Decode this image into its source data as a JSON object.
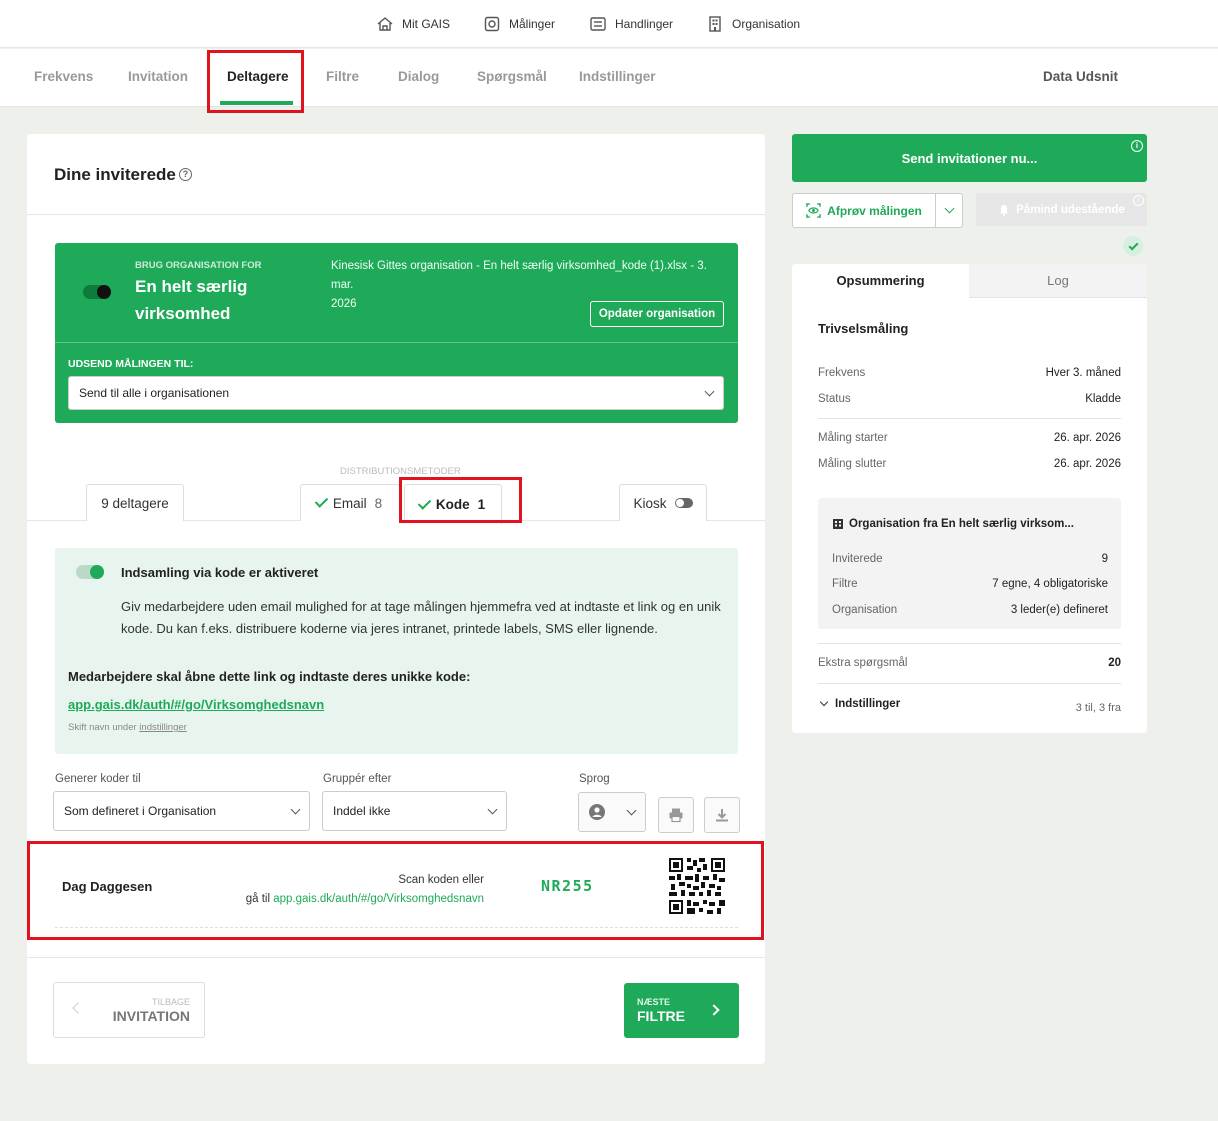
{
  "topnav": {
    "items": [
      {
        "label": "Mit GAIS",
        "icon": "home-icon"
      },
      {
        "label": "Målinger",
        "icon": "survey-icon"
      },
      {
        "label": "Handlinger",
        "icon": "actions-icon"
      },
      {
        "label": "Organisation",
        "icon": "building-icon"
      }
    ]
  },
  "subnav": {
    "tabs": [
      "Frekvens",
      "Invitation",
      "Deltagere",
      "Filtre",
      "Dialog",
      "Spørgsmål",
      "Indstillinger"
    ],
    "active": "Deltagere",
    "right_label": "Data Udsnit"
  },
  "main": {
    "title": "Dine inviterede",
    "org_box": {
      "small_label": "BRUG ORGANISATION FOR",
      "org_name_line1": "En helt særlig",
      "org_name_line2": "virksomhed",
      "file_info_line1": "Kinesisk Gittes organisation - En helt særlig virksomhed_kode (1).xlsx - 3. mar.",
      "file_info_line2": "2026",
      "update_button": "Opdater organisation",
      "send_label": "UDSEND MÅLINGEN TIL:",
      "send_select": "Send til alle i organisationen"
    },
    "distribution": {
      "label": "DISTRIBUTIONSMETODER",
      "participants_tab": "9  deltagere",
      "email_tab": "Email",
      "email_count": "8",
      "code_tab": "Kode",
      "code_count": "1",
      "kiosk_tab": "Kiosk"
    },
    "code_box": {
      "title": "Indsamling via kode er aktiveret",
      "description_line1": "Giv medarbejdere uden email mulighed for at tage målingen hjemmefra ved at indtaste et link og en unik",
      "description_line2": "kode. Du kan f.eks. distribuere koderne via jeres intranet, printede labels, SMS eller lignende.",
      "link_heading": "Medarbejdere skal åbne dette link og indtaste deres unikke kode:",
      "link": "app.gais.dk/auth/#/go/Virksomghedsnavn",
      "rename_hint_prefix": "Skift navn under",
      "rename_hint_link": "indstillinger"
    },
    "controls": {
      "generate_label": "Generer koder til",
      "generate_value": "Som defineret i Organisation",
      "group_label": "Gruppér efter",
      "group_value": "Inddel ikke",
      "language_label": "Sprog"
    },
    "code_row": {
      "name": "Dag Daggesen",
      "scan_text": "Scan koden eller",
      "goto_prefix": "gå til",
      "goto_link": "app.gais.dk/auth/#/go/Virksomghedsnavn",
      "code": "NR255"
    },
    "footer": {
      "back_small": "TILBAGE",
      "back_big": "INVITATION",
      "next_small": "NÆSTE",
      "next_big": "FILTRE"
    }
  },
  "sidebar": {
    "send_button": "Send invitationer nu...",
    "test_button": "Afprøv målingen",
    "remind_button": "Påmind udestående",
    "tabs": [
      "Opsummering",
      "Log"
    ],
    "title": "Trivselsmåling",
    "rows1": [
      {
        "label": "Frekvens",
        "value": "Hver 3. måned"
      },
      {
        "label": "Status",
        "value": "Kladde"
      }
    ],
    "rows2": [
      {
        "label": "Måling starter",
        "value": "26. apr. 2026"
      },
      {
        "label": "Måling slutter",
        "value": "26. apr. 2026"
      }
    ],
    "org_panel": {
      "title": "Organisation fra En helt særlig virksom...",
      "rows": [
        {
          "label": "Inviterede",
          "value": "9"
        },
        {
          "label": "Filtre",
          "value": "7 egne, 4 obligatoriske"
        },
        {
          "label": "Organisation",
          "value": "3 leder(e) defineret"
        }
      ]
    },
    "extra_label": "Ekstra spørgsmål",
    "extra_value": "20",
    "settings_label": "Indstillinger",
    "settings_value": "3 til, 3 fra"
  },
  "colors": {
    "accent": "#1faa59",
    "highlight": "#e0131e"
  }
}
